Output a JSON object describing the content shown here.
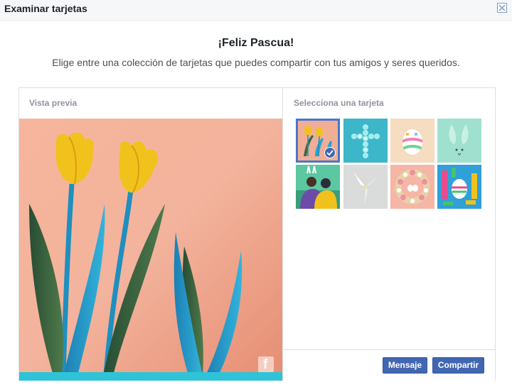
{
  "window": {
    "title": "Examinar tarjetas",
    "close_label": "Cerrar"
  },
  "header": {
    "heading": "¡Feliz Pascua!",
    "subtitle": "Elige entre una colección de tarjetas que puedes compartir con tus amigos y seres queridos."
  },
  "preview": {
    "label": "Vista previa",
    "watermark": "f"
  },
  "selector": {
    "label": "Selecciona una tarjeta",
    "cards": [
      {
        "name": "tulips",
        "selected": true
      },
      {
        "name": "flower-cross",
        "selected": false
      },
      {
        "name": "easter-egg",
        "selected": false
      },
      {
        "name": "bunny-ears",
        "selected": false
      },
      {
        "name": "family-hug",
        "selected": false
      },
      {
        "name": "white-lily",
        "selected": false
      },
      {
        "name": "flower-wreath",
        "selected": false
      },
      {
        "name": "colorful-eggs",
        "selected": false
      }
    ]
  },
  "actions": {
    "message_label": "Mensaje",
    "share_label": "Compartir"
  },
  "colors": {
    "accent": "#4267b2",
    "selection_border": "#4a76c8"
  }
}
